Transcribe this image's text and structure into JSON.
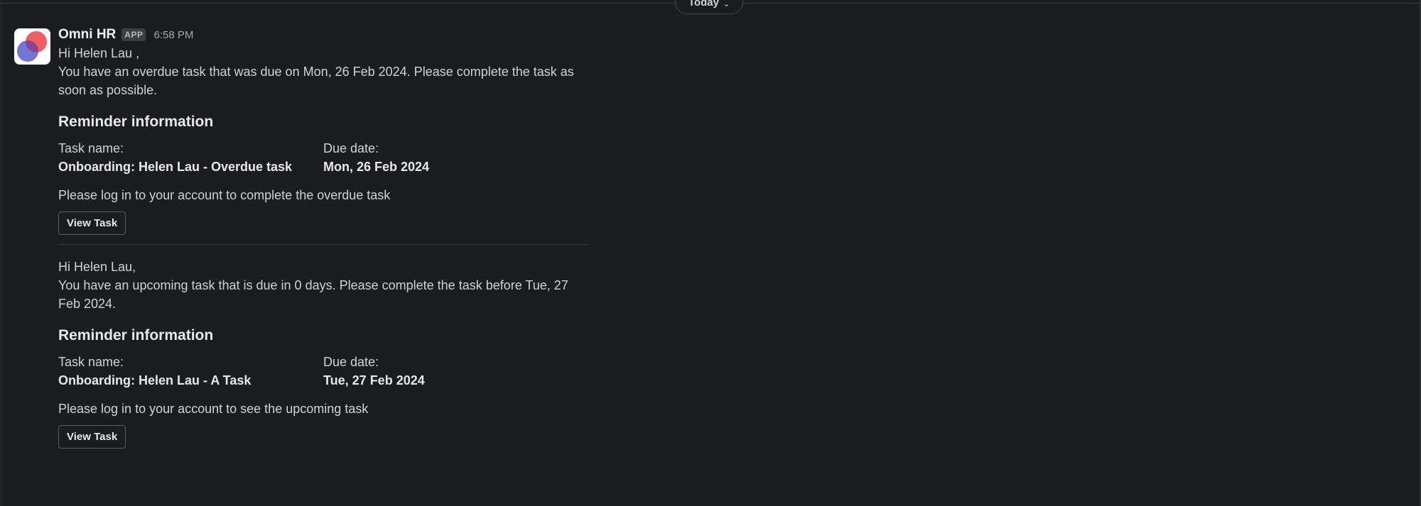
{
  "day_divider": {
    "label": "Today"
  },
  "message": {
    "sender": "Omni HR",
    "badge": "APP",
    "time": "6:58 PM",
    "sections": [
      {
        "greeting": "Hi Helen Lau ,",
        "body_line1": "You have an overdue task that was due on Mon, 26 Feb 2024. Please complete the task as",
        "body_line2": "soon as possible.",
        "heading": "Reminder information",
        "task_label": "Task name:",
        "task_value": "Onboarding: Helen Lau - Overdue task",
        "due_label": "Due date:",
        "due_value": "Mon, 26 Feb 2024",
        "instruction": "Please log in to your account to complete the overdue task",
        "button": "View Task"
      },
      {
        "greeting": "Hi Helen Lau,",
        "body_line1": "You have an upcoming task that is due in 0 days. Please complete the task before Tue, 27",
        "body_line2": "Feb 2024.",
        "heading": "Reminder information",
        "task_label": "Task name:",
        "task_value": "Onboarding: Helen Lau - A Task",
        "due_label": "Due date:",
        "due_value": "Tue, 27 Feb 2024",
        "instruction": "Please log in to your account to see the upcoming task",
        "button": "View Task"
      }
    ]
  },
  "colors": {
    "background": "#1b1c1f",
    "text": "#d1d2d3",
    "logo_red": "#f05d63",
    "logo_purple": "#6b6fd4"
  }
}
